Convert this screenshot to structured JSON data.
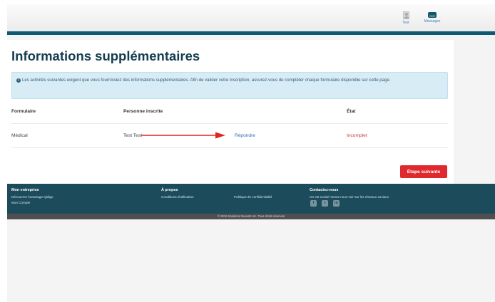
{
  "header": {
    "user_label": "Test",
    "messages_label": "Messages"
  },
  "page": {
    "title": "Informations supplémentaires",
    "info_text": "Les activités suivantes exigent que vous fournissiez des informations supplémentaires. Afin de valider votre inscription, assurez-vous de compléter chaque formulaire disponible sur cette page."
  },
  "table": {
    "headers": {
      "form": "Formulaire",
      "person": "Personne inscrite",
      "status": "État"
    },
    "rows": [
      {
        "form": "Médical",
        "person": "Test Test",
        "action": "Répondre",
        "status": "Incomplet"
      }
    ]
  },
  "actions": {
    "next_label": "Étape suivante"
  },
  "footer": {
    "col1": {
      "title": "Mon entreprise",
      "links": [
        "Découvrez l'avantage Qidigo",
        "Mon Compte"
      ]
    },
    "col2": {
      "title": "À propos",
      "links": [
        "Conditions d'utilisation",
        "Politique de confidentialité"
      ]
    },
    "col3": {
      "title": "Contactez-nous",
      "text": "On est social! Venez nous voir sur les réseaux sociaux",
      "social": [
        "f",
        "t",
        "in"
      ]
    },
    "copyright": "© 2016 Solutions Nexarts Inc. Tous droits réservés"
  },
  "colors": {
    "teal": "#0f5a72",
    "footer": "#1c4c5b",
    "danger": "#e0292e",
    "link": "#2f6fb0"
  }
}
